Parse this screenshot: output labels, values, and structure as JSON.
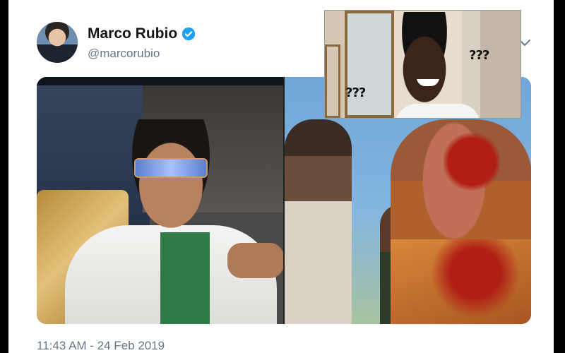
{
  "tweet": {
    "author_name": "Marco Rubio",
    "author_handle": "@marcorubio",
    "verified": true,
    "timestamp": "11:43 AM - 24 Feb 2019"
  },
  "meme": {
    "left_text": "???",
    "right_text": "???"
  },
  "colors": {
    "verified_blue": "#1da1f2",
    "handle_gray": "#657786",
    "name_black": "#14171a"
  },
  "icons": {
    "verified": "verified-badge-icon",
    "menu": "chevron-down-icon"
  }
}
